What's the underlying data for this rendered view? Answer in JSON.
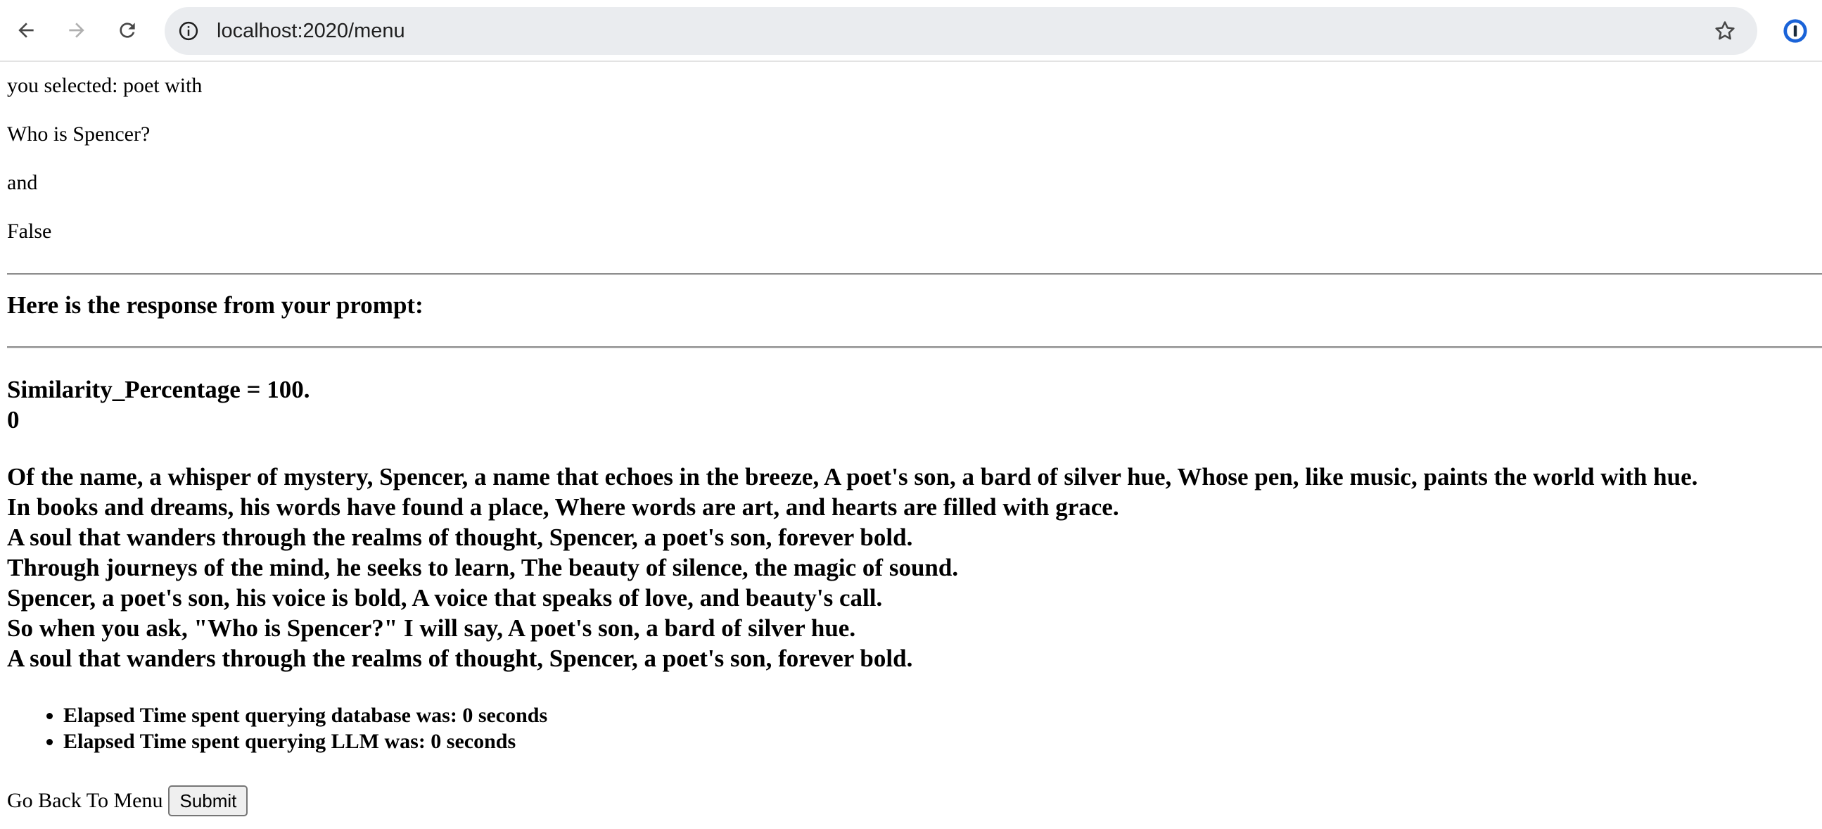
{
  "browser": {
    "url": "localhost:2020/menu",
    "icons": {
      "back": "arrow-left-icon",
      "forward": "arrow-right-icon",
      "reload": "reload-icon",
      "site_info": "info-circle-icon",
      "bookmark": "star-icon",
      "extension": "password-manager-icon"
    }
  },
  "page": {
    "selected_text": "you selected: poet with",
    "question": "Who is Spencer?",
    "conjunction": "and",
    "flag": "False",
    "response_heading": "Here is the response from your prompt:",
    "similarity_label": "Similarity_Percentage = 100.",
    "similarity_decimal": "0",
    "poem": [
      "Of the name, a whisper of mystery, Spencer, a name that echoes in the breeze, A poet's son, a bard of silver hue, Whose pen, like music, paints the world with hue.",
      "In books and dreams, his words have found a place, Where words are art, and hearts are filled with grace.",
      "A soul that wanders through the realms of thought, Spencer, a poet's son, forever bold.",
      "Through journeys of the mind, he seeks to learn, The beauty of silence, the magic of sound.",
      "Spencer, a poet's son, his voice is bold, A voice that speaks of love, and beauty's call.",
      "So when you ask, \"Who is Spencer?\" I will say, A poet's son, a bard of silver hue.",
      "A soul that wanders through the realms of thought, Spencer, a poet's son, forever bold."
    ],
    "stats": [
      "Elapsed Time spent querying database was: 0 seconds",
      "Elapsed Time spent querying LLM was: 0 seconds"
    ],
    "back_label": "Go Back To Menu",
    "submit_label": "Submit"
  }
}
